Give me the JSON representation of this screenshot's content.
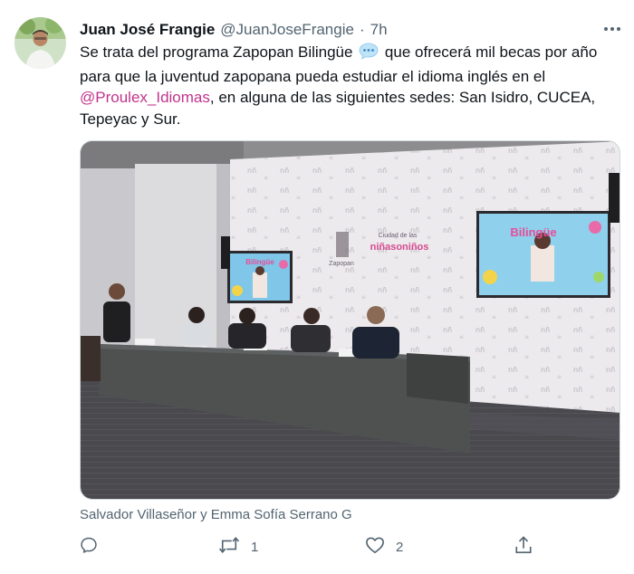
{
  "tweet": {
    "author_name": "Juan José Frangie",
    "author_handle": "@JuanJoseFrangie",
    "separator": "·",
    "time": "7h",
    "more_icon": "more-icon",
    "text_part1": "Se trata del programa Zapopan Bilingüe",
    "text_part2": " que ofrecerá mil becas por año para que la juventud zapopana pueda estudiar el idioma inglés en el ",
    "mention": "@Proulex_Idiomas",
    "text_part3": ", en alguna de las siguientes sedes: San Isidro, CUCEA, Tepeyac y Sur."
  },
  "media": {
    "caption": "Salvador Villaseñor y Emma Sofía Serrano G",
    "screen_left_title": "Bilingüe",
    "screen_right_title": "Bilingüe",
    "banner_logo_text": "Zapopan",
    "banner_text": "Ciudad de las",
    "banner_text2": "niñasoniños"
  },
  "actions": {
    "reply_count": "",
    "retweet_count": "1",
    "like_count": "2"
  },
  "colors": {
    "mention": "#c2338c",
    "secondary": "#536471",
    "wall": "#e9e7ea",
    "carpet": "#46454a",
    "table": "#4d4f4f"
  }
}
